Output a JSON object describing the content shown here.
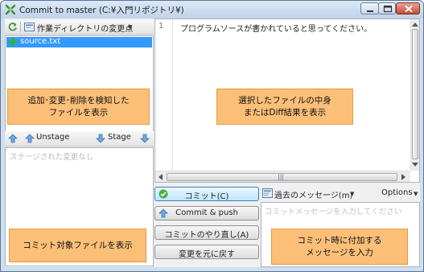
{
  "window": {
    "title": "Commit to master (C:¥入門リポジトリ¥)"
  },
  "workspace": {
    "dropdown_label": "作業ディレクトリの変更点",
    "files": [
      {
        "name": "source.txt",
        "status": "added"
      }
    ]
  },
  "staging": {
    "unstage_label": "Unstage",
    "stage_label": "Stage",
    "empty_text": "ステージされた変更なし"
  },
  "diff": {
    "line_number": "1",
    "line_text": "プログラムソースが書かれていると思ってください。"
  },
  "actions": {
    "commit": "コミット(C)",
    "commit_push": "Commit & push",
    "commit_redo": "コミットのやり直し(A)",
    "revert": "変更を元に戻す"
  },
  "message": {
    "past_messages": "過去のメッセージ(m)",
    "options": "Options",
    "placeholder": "コミットメッセージを入力してください"
  },
  "callouts": {
    "detect": [
      "追加･変更･削除を検知した",
      "ファイルを表示"
    ],
    "diff": [
      "選択したファイルの中身",
      "またはDiff結果を表示"
    ],
    "commit_files": [
      "コミット対象ファイルを表示"
    ],
    "message": [
      "コミット時に付加する",
      "メッセージを入力"
    ]
  },
  "colors": {
    "selection": "#3399ff",
    "callout_fill": "#fbbf78",
    "callout_border": "#e69a42"
  }
}
